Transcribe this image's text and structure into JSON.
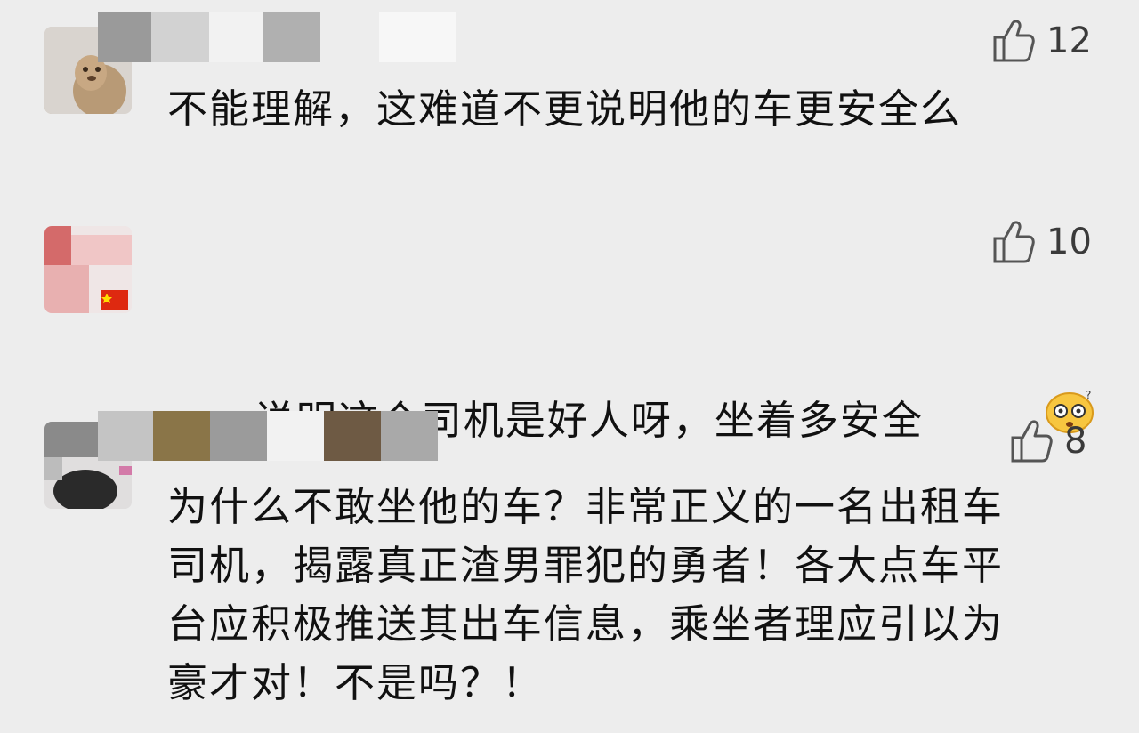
{
  "comments": [
    {
      "text": "不能理解，这难道不更说明他的车更安全么",
      "likes": "12"
    },
    {
      "text": "说明这个司机是好人呀，坐着多安全",
      "likes": "10",
      "emoji": "dizzy-face-emoji"
    },
    {
      "text": "为什么不敢坐他的车？非常正义的一名出租车\n司机，揭露真正渣男罪犯的勇者！各大点车平\n台应积极推送其出车信息，乘坐者理应引以为\n豪才对！不是吗？！",
      "likes": "8"
    }
  ],
  "icons": {
    "like": "thumbs-up-icon"
  },
  "colors": {
    "background": "#ededed",
    "text": "#111111",
    "like": "#444444"
  }
}
